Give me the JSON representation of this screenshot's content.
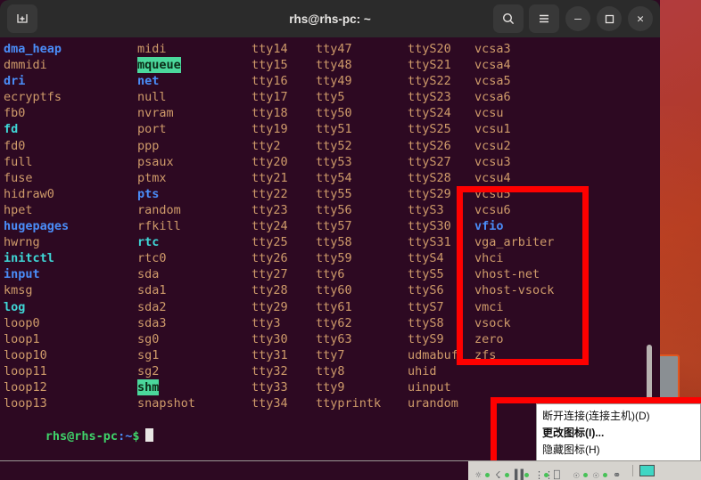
{
  "window": {
    "title": "rhs@rhs-pc: ~",
    "new_tab_icon": "new-tab-icon",
    "search_icon": "search-icon",
    "menu_icon": "hamburger-menu-icon",
    "minimize_label": "–",
    "maximize_label": "❐",
    "close_label": "✕"
  },
  "terminal": {
    "prompt": {
      "user_host": "rhs@rhs-pc",
      "colon": ":",
      "path": "~",
      "sigil": "$"
    },
    "columns_x": [
      2,
      152,
      280,
      352,
      455,
      530
    ],
    "rows": [
      [
        {
          "t": "dma_heap",
          "c": "dir"
        },
        {
          "t": "midi",
          "c": "dev"
        },
        {
          "t": "tty14",
          "c": "dev"
        },
        {
          "t": "tty47",
          "c": "dev"
        },
        {
          "t": "ttyS20",
          "c": "dev"
        },
        {
          "t": "vcsa3",
          "c": "dev"
        }
      ],
      [
        {
          "t": "dmmidi",
          "c": "dev"
        },
        {
          "t": "mqueue",
          "c": "sticky"
        },
        {
          "t": "tty15",
          "c": "dev"
        },
        {
          "t": "tty48",
          "c": "dev"
        },
        {
          "t": "ttyS21",
          "c": "dev"
        },
        {
          "t": "vcsa4",
          "c": "dev"
        }
      ],
      [
        {
          "t": "dri",
          "c": "dir"
        },
        {
          "t": "net",
          "c": "dir"
        },
        {
          "t": "tty16",
          "c": "dev"
        },
        {
          "t": "tty49",
          "c": "dev"
        },
        {
          "t": "ttyS22",
          "c": "dev"
        },
        {
          "t": "vcsa5",
          "c": "dev"
        }
      ],
      [
        {
          "t": "ecryptfs",
          "c": "dev"
        },
        {
          "t": "null",
          "c": "dev"
        },
        {
          "t": "tty17",
          "c": "dev"
        },
        {
          "t": "tty5",
          "c": "dev"
        },
        {
          "t": "ttyS23",
          "c": "dev"
        },
        {
          "t": "vcsa6",
          "c": "dev"
        }
      ],
      [
        {
          "t": "fb0",
          "c": "dev"
        },
        {
          "t": "nvram",
          "c": "dev"
        },
        {
          "t": "tty18",
          "c": "dev"
        },
        {
          "t": "tty50",
          "c": "dev"
        },
        {
          "t": "ttyS24",
          "c": "dev"
        },
        {
          "t": "vcsu",
          "c": "dev"
        }
      ],
      [
        {
          "t": "fd",
          "c": "link"
        },
        {
          "t": "port",
          "c": "dev"
        },
        {
          "t": "tty19",
          "c": "dev"
        },
        {
          "t": "tty51",
          "c": "dev"
        },
        {
          "t": "ttyS25",
          "c": "dev"
        },
        {
          "t": "vcsu1",
          "c": "dev"
        }
      ],
      [
        {
          "t": "fd0",
          "c": "dev"
        },
        {
          "t": "ppp",
          "c": "dev"
        },
        {
          "t": "tty2",
          "c": "dev"
        },
        {
          "t": "tty52",
          "c": "dev"
        },
        {
          "t": "ttyS26",
          "c": "dev"
        },
        {
          "t": "vcsu2",
          "c": "dev"
        }
      ],
      [
        {
          "t": "full",
          "c": "dev"
        },
        {
          "t": "psaux",
          "c": "dev"
        },
        {
          "t": "tty20",
          "c": "dev"
        },
        {
          "t": "tty53",
          "c": "dev"
        },
        {
          "t": "ttyS27",
          "c": "dev"
        },
        {
          "t": "vcsu3",
          "c": "dev"
        }
      ],
      [
        {
          "t": "fuse",
          "c": "dev"
        },
        {
          "t": "ptmx",
          "c": "dev"
        },
        {
          "t": "tty21",
          "c": "dev"
        },
        {
          "t": "tty54",
          "c": "dev"
        },
        {
          "t": "ttyS28",
          "c": "dev"
        },
        {
          "t": "vcsu4",
          "c": "dev"
        }
      ],
      [
        {
          "t": "hidraw0",
          "c": "dev"
        },
        {
          "t": "pts",
          "c": "dir"
        },
        {
          "t": "tty22",
          "c": "dev"
        },
        {
          "t": "tty55",
          "c": "dev"
        },
        {
          "t": "ttyS29",
          "c": "dev"
        },
        {
          "t": "vcsu5",
          "c": "dev"
        }
      ],
      [
        {
          "t": "hpet",
          "c": "dev"
        },
        {
          "t": "random",
          "c": "dev"
        },
        {
          "t": "tty23",
          "c": "dev"
        },
        {
          "t": "tty56",
          "c": "dev"
        },
        {
          "t": "ttyS3",
          "c": "dev"
        },
        {
          "t": "vcsu6",
          "c": "dev"
        }
      ],
      [
        {
          "t": "hugepages",
          "c": "dir"
        },
        {
          "t": "rfkill",
          "c": "dev"
        },
        {
          "t": "tty24",
          "c": "dev"
        },
        {
          "t": "tty57",
          "c": "dev"
        },
        {
          "t": "ttyS30",
          "c": "dev"
        },
        {
          "t": "vfio",
          "c": "dir"
        }
      ],
      [
        {
          "t": "hwrng",
          "c": "dev"
        },
        {
          "t": "rtc",
          "c": "link"
        },
        {
          "t": "tty25",
          "c": "dev"
        },
        {
          "t": "tty58",
          "c": "dev"
        },
        {
          "t": "ttyS31",
          "c": "dev"
        },
        {
          "t": "vga_arbiter",
          "c": "dev"
        }
      ],
      [
        {
          "t": "initctl",
          "c": "link"
        },
        {
          "t": "rtc0",
          "c": "dev"
        },
        {
          "t": "tty26",
          "c": "dev"
        },
        {
          "t": "tty59",
          "c": "dev"
        },
        {
          "t": "ttyS4",
          "c": "dev"
        },
        {
          "t": "vhci",
          "c": "dev"
        }
      ],
      [
        {
          "t": "input",
          "c": "dir"
        },
        {
          "t": "sda",
          "c": "dev"
        },
        {
          "t": "tty27",
          "c": "dev"
        },
        {
          "t": "tty6",
          "c": "dev"
        },
        {
          "t": "ttyS5",
          "c": "dev"
        },
        {
          "t": "vhost-net",
          "c": "dev"
        }
      ],
      [
        {
          "t": "kmsg",
          "c": "dev"
        },
        {
          "t": "sda1",
          "c": "dev"
        },
        {
          "t": "tty28",
          "c": "dev"
        },
        {
          "t": "tty60",
          "c": "dev"
        },
        {
          "t": "ttyS6",
          "c": "dev"
        },
        {
          "t": "vhost-vsock",
          "c": "dev"
        }
      ],
      [
        {
          "t": "log",
          "c": "link"
        },
        {
          "t": "sda2",
          "c": "dev"
        },
        {
          "t": "tty29",
          "c": "dev"
        },
        {
          "t": "tty61",
          "c": "dev"
        },
        {
          "t": "ttyS7",
          "c": "dev"
        },
        {
          "t": "vmci",
          "c": "dev"
        }
      ],
      [
        {
          "t": "loop0",
          "c": "dev"
        },
        {
          "t": "sda3",
          "c": "dev"
        },
        {
          "t": "tty3",
          "c": "dev"
        },
        {
          "t": "tty62",
          "c": "dev"
        },
        {
          "t": "ttyS8",
          "c": "dev"
        },
        {
          "t": "vsock",
          "c": "dev"
        }
      ],
      [
        {
          "t": "loop1",
          "c": "dev"
        },
        {
          "t": "sg0",
          "c": "dev"
        },
        {
          "t": "tty30",
          "c": "dev"
        },
        {
          "t": "tty63",
          "c": "dev"
        },
        {
          "t": "ttyS9",
          "c": "dev"
        },
        {
          "t": "zero",
          "c": "dev"
        }
      ],
      [
        {
          "t": "loop10",
          "c": "dev"
        },
        {
          "t": "sg1",
          "c": "dev"
        },
        {
          "t": "tty31",
          "c": "dev"
        },
        {
          "t": "tty7",
          "c": "dev"
        },
        {
          "t": "udmabuf",
          "c": "dev"
        },
        {
          "t": "zfs",
          "c": "dev"
        }
      ],
      [
        {
          "t": "loop11",
          "c": "dev"
        },
        {
          "t": "sg2",
          "c": "dev"
        },
        {
          "t": "tty32",
          "c": "dev"
        },
        {
          "t": "tty8",
          "c": "dev"
        },
        {
          "t": "uhid",
          "c": "dev"
        },
        null
      ],
      [
        {
          "t": "loop12",
          "c": "dev"
        },
        {
          "t": "shm",
          "c": "sticky"
        },
        {
          "t": "tty33",
          "c": "dev"
        },
        {
          "t": "tty9",
          "c": "dev"
        },
        {
          "t": "uinput",
          "c": "dev"
        },
        null
      ],
      [
        {
          "t": "loop13",
          "c": "dev"
        },
        {
          "t": "snapshot",
          "c": "dev"
        },
        {
          "t": "tty34",
          "c": "dev"
        },
        {
          "t": "ttyprintk",
          "c": "dev"
        },
        {
          "t": "urandom",
          "c": "dev"
        },
        null
      ]
    ]
  },
  "context_menu": {
    "items": [
      {
        "label": "断开连接(连接主机)(D)",
        "bold": false
      },
      {
        "label": "更改图标(I)...",
        "bold": true
      },
      {
        "label": "隐藏图标(H)",
        "bold": false
      }
    ]
  },
  "annotations": {
    "color": "#fe0000",
    "boxes": [
      {
        "name": "devices-highlight",
        "target": "vcsu5-through-zfs"
      },
      {
        "name": "context-menu-highlight",
        "target": "tray-context-menu"
      }
    ]
  },
  "taskbar": {
    "tray_icons": [
      "network-connection-icon",
      "network-connection-icon",
      "network-stats-icon",
      "network-dotted-icon",
      "monitor-icon",
      "network-link-icon",
      "network-link-icon",
      "shield-icon"
    ],
    "document_icon": "document-icon"
  }
}
